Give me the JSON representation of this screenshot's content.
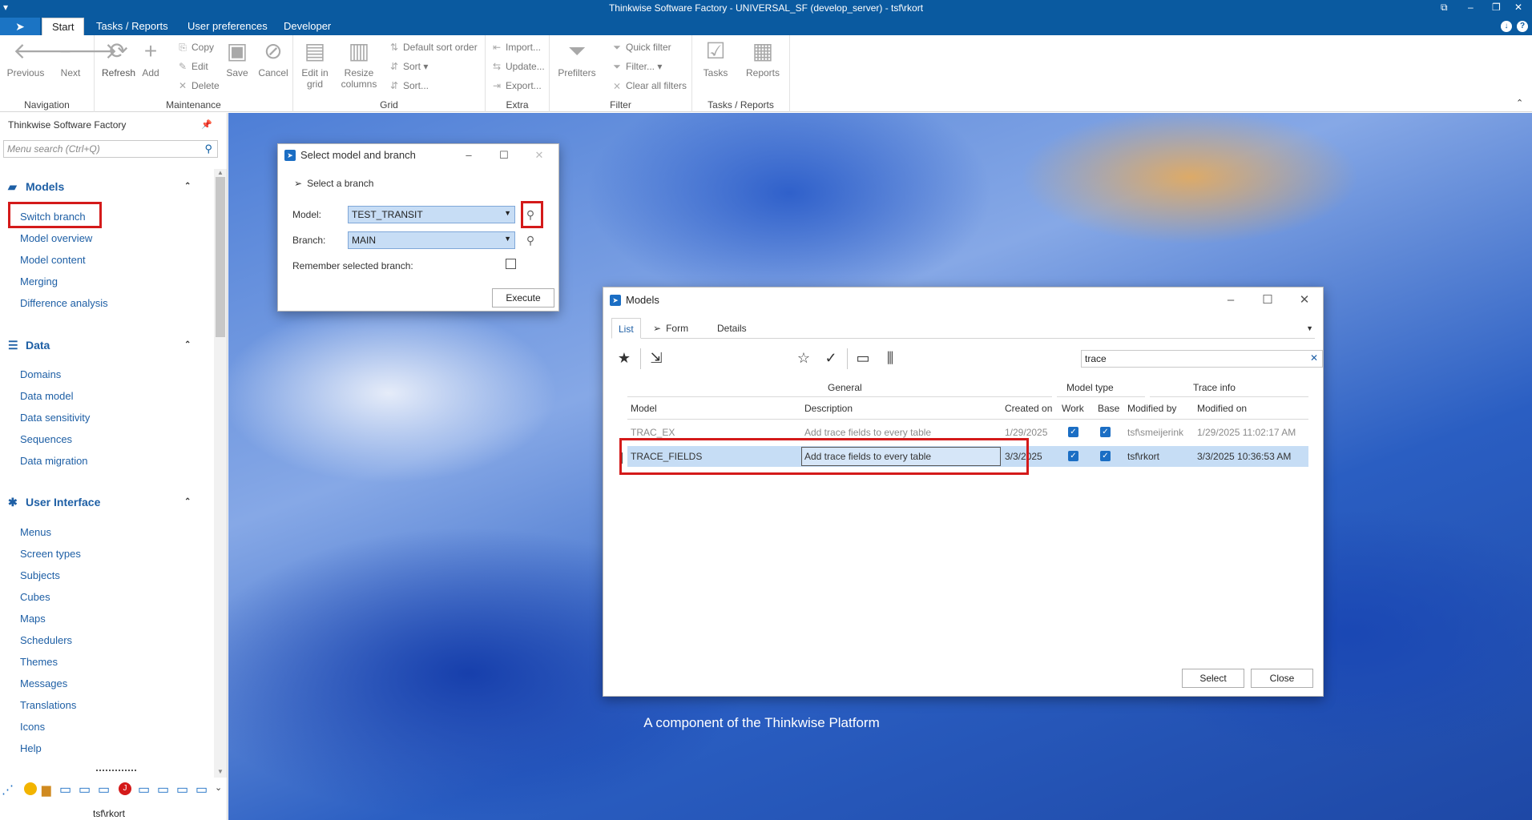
{
  "window": {
    "title": "Thinkwise Software Factory - UNIVERSAL_SF (develop_server) - tsf\\rkort"
  },
  "tabs": [
    {
      "label": "Start",
      "active": true
    },
    {
      "label": "Tasks / Reports"
    },
    {
      "label": "User preferences"
    },
    {
      "label": "Developer"
    }
  ],
  "ribbon": {
    "navigation": {
      "label": "Navigation",
      "previous": "Previous",
      "next": "Next"
    },
    "maintenance": {
      "label": "Maintenance",
      "refresh": "Refresh",
      "add": "Add",
      "copy": "Copy",
      "edit": "Edit",
      "delete": "Delete",
      "save": "Save",
      "cancel": "Cancel"
    },
    "grid": {
      "label": "Grid",
      "edit_in_grid": "Edit in grid",
      "resize_columns": "Resize columns",
      "default_sort": "Default sort order",
      "sort": "Sort",
      "sort_dialog": "Sort..."
    },
    "extra": {
      "label": "Extra",
      "import": "Import...",
      "update": "Update...",
      "export": "Export..."
    },
    "filter": {
      "label": "Filter",
      "prefilters": "Prefilters",
      "quick_filter": "Quick filter",
      "filter": "Filter...",
      "clear_all": "Clear all filters"
    },
    "tasks_reports": {
      "label": "Tasks / Reports",
      "tasks": "Tasks",
      "reports": "Reports"
    }
  },
  "sidebar": {
    "title": "Thinkwise Software Factory",
    "search_placeholder": "Menu search (Ctrl+Q)",
    "groups": [
      {
        "label": "Models",
        "items": [
          "Switch branch",
          "Model overview",
          "Model content",
          "Merging",
          "Difference analysis"
        ]
      },
      {
        "label": "Data",
        "items": [
          "Domains",
          "Data model",
          "Data sensitivity",
          "Sequences",
          "Data migration"
        ]
      },
      {
        "label": "User Interface",
        "items": [
          "Menus",
          "Screen types",
          "Subjects",
          "Cubes",
          "Maps",
          "Schedulers",
          "Themes",
          "Messages",
          "Translations",
          "Icons",
          "Help"
        ]
      }
    ],
    "user": "tsf\\rkort"
  },
  "background": {
    "tagline": "A component of the Thinkwise Platform"
  },
  "branch_dialog": {
    "title": "Select model and branch",
    "subtitle": "Select a branch",
    "model_label": "Model:",
    "model_value": "TEST_TRANSIT",
    "branch_label": "Branch:",
    "branch_value": "MAIN",
    "remember_label": "Remember selected branch:",
    "execute": "Execute"
  },
  "models_dialog": {
    "title": "Models",
    "tabs": [
      "List",
      "Form",
      "Details"
    ],
    "search_value": "trace",
    "group_headers": {
      "general": "General",
      "model_type": "Model type",
      "trace_info": "Trace info"
    },
    "columns": [
      "Model",
      "Description",
      "Created on",
      "Work",
      "Base",
      "Modified by",
      "Modified on"
    ],
    "rows": [
      {
        "model": "TRAC_EX",
        "description": "Add trace fields to every table",
        "created_on": "1/29/2025",
        "work": true,
        "base": true,
        "modified_by": "tsf\\smeijerink",
        "modified_on": "1/29/2025 11:02:17 AM"
      },
      {
        "model": "TRACE_FIELDS",
        "description": "Add trace fields to every table",
        "created_on": "3/3/2025",
        "work": true,
        "base": true,
        "modified_by": "tsf\\rkort",
        "modified_on": "3/3/2025 10:36:53 AM"
      }
    ],
    "select": "Select",
    "close": "Close"
  }
}
